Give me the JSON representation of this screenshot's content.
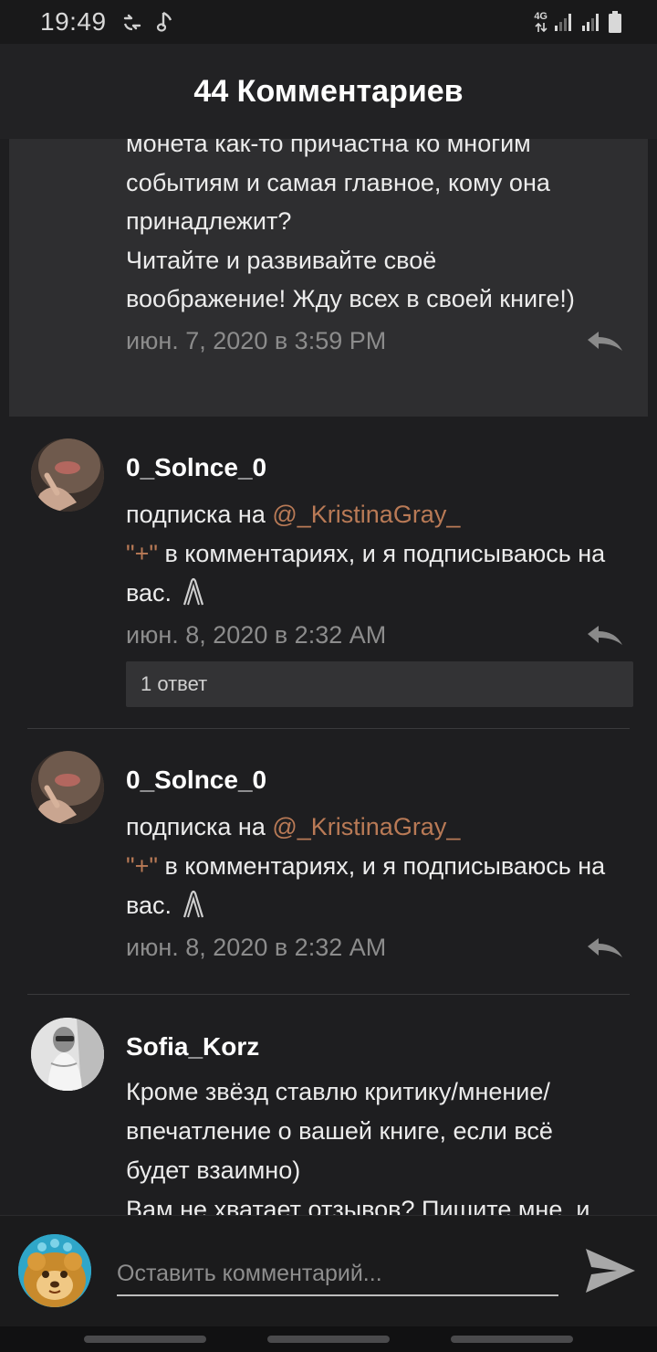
{
  "status_bar": {
    "time": "19:49",
    "network": "4G",
    "icons": [
      "data-transfer-icon",
      "music-note-icon",
      "signal-icon",
      "signal-icon",
      "battery-icon"
    ]
  },
  "header": {
    "title": "44 Комментариев"
  },
  "previous_comment": {
    "text": "монета как-то причастна ко многим\nсобытиям и самая главное, кому она\nпринадлежит?\n  Читайте и развивайте своё\nвоображение! Жду всех в своей книге!)",
    "timestamp": "июн. 7, 2020 в 3:59 PM"
  },
  "comments": [
    {
      "username": "0_Solnce_0",
      "text_prefix": "подписка на ",
      "mention": "@_KristinaGray_",
      "plus": "\"+\"",
      "text_suffix": " в комментариях, и я подписываюсь на вас.",
      "timestamp": "июн. 8, 2020 в 2:32 AM",
      "replies_label": "1 ответ"
    },
    {
      "username": "0_Solnce_0",
      "text_prefix": "подписка на ",
      "mention": "@_KristinaGray_",
      "plus": "\"+\"",
      "text_suffix": " в комментариях, и я подписываюсь на вас.",
      "timestamp": "июн. 8, 2020 в 2:32 AM"
    },
    {
      "username": "Sofia_Korz",
      "text": "Кроме звёзд ставлю критику/мнение/\nвпечатление о вашей книге, если всё\nбудет взаимно)\n   Вам не хватает отзывов? Пишите мне, и"
    }
  ],
  "composer": {
    "placeholder": "Оставить комментарий..."
  },
  "colors": {
    "background": "#1e1e20",
    "highlight": "#2e2e30",
    "mention": "#b97a56",
    "timestamp": "#8c8c8c"
  }
}
